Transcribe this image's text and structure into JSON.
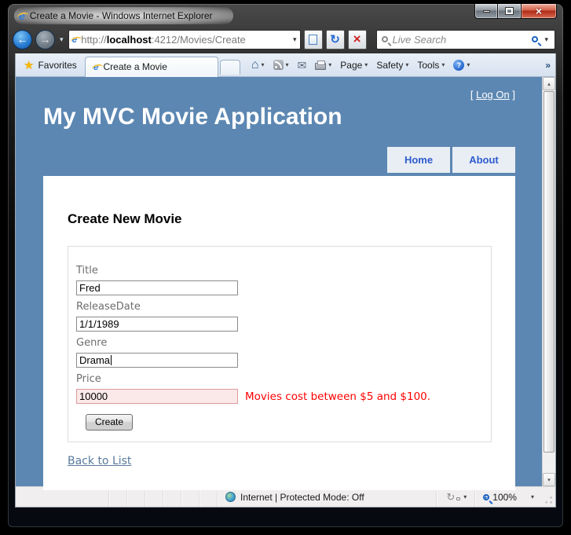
{
  "colors": {
    "viewport_blue": "#5c87b2",
    "tab_background": "#e8eef4",
    "tab_text": "#2f5bce",
    "error_red": "#ff0000",
    "error_input_bg": "#fbe9e9",
    "link_color": "#5a7a9c",
    "close_button_red": "#b02a17"
  },
  "titlebar": {
    "title": "Create a Movie - Windows Internet Explorer"
  },
  "toolbar": {
    "url_prefix": "http://",
    "url_host": "localhost",
    "url_path": ":4212/Movies/Create",
    "search_placeholder": "Live Search"
  },
  "favorites_bar": {
    "favorites_label": "Favorites",
    "tab_title": "Create a Movie",
    "page_label": "Page",
    "safety_label": "Safety",
    "tools_label": "Tools",
    "more_chevron": "»"
  },
  "page": {
    "log_on_prefix": "[",
    "log_on_label": "Log On",
    "log_on_suffix": "]",
    "heading": "My MVC Movie Application",
    "nav": [
      {
        "label": "Home"
      },
      {
        "label": "About"
      }
    ],
    "content": {
      "title": "Create New Movie",
      "fields": [
        {
          "label": "Title",
          "value": "Fred"
        },
        {
          "label": "ReleaseDate",
          "value": "1/1/1989"
        },
        {
          "label": "Genre",
          "value": "Drama"
        },
        {
          "label": "Price",
          "value": "10000",
          "error": "Movies cost between $5 and $100."
        }
      ],
      "create_button": "Create",
      "back_link": "Back to List"
    }
  },
  "statusbar": {
    "zone_text": "Internet | Protected Mode: Off",
    "zoom_level": "100%"
  }
}
